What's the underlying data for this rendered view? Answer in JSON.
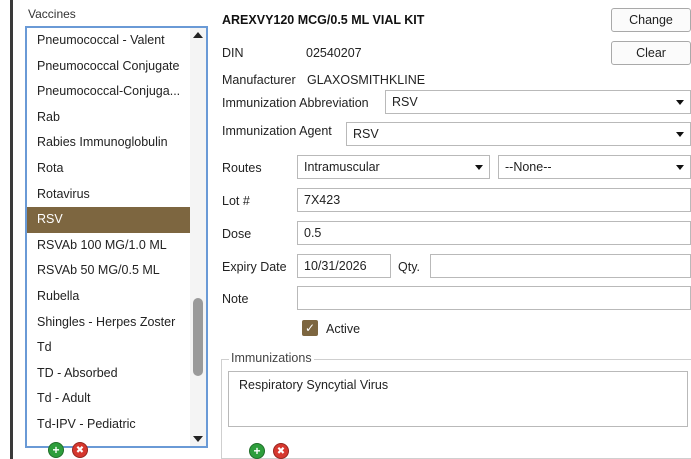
{
  "vaccines": {
    "title": "Vaccines",
    "items": [
      "Pneumococcal - Valent",
      "Pneumococcal Conjugate",
      "Pneumococcal-Conjuga...",
      "Rab",
      "Rabies Immunoglobulin",
      "Rota",
      "Rotavirus",
      "RSV",
      "RSVAb 100 MG/1.0 ML",
      "RSVAb 50 MG/0.5 ML",
      "Rubella",
      "Shingles - Herpes Zoster",
      "Td",
      "TD - Absorbed",
      "Td - Adult",
      "Td-IPV - Pediatric"
    ],
    "selected_index": 7,
    "add_glyph": "+",
    "remove_glyph": "✖"
  },
  "product": {
    "title": "AREXVY120 MCG/0.5 ML VIAL KIT",
    "change_label": "Change",
    "clear_label": "Clear"
  },
  "form": {
    "din_label": "DIN",
    "din_value": "02540207",
    "manufacturer_label": "Manufacturer",
    "manufacturer_value": "GLAXOSMITHKLINE",
    "abbreviation_label": "Immunization Abbreviation",
    "abbreviation_value": "RSV",
    "agent_label": "Immunization Agent",
    "agent_value": "RSV",
    "routes_label": "Routes",
    "route_value": "Intramuscular",
    "site_value": "--None--",
    "lot_label": "Lot #",
    "lot_value": "7X423",
    "dose_label": "Dose",
    "dose_value": "0.5",
    "expiry_label": "Expiry Date",
    "expiry_value": "10/31/2026",
    "qty_label": "Qty.",
    "qty_value": "",
    "note_label": "Note",
    "note_value": "",
    "active_label": "Active",
    "active_checked": true
  },
  "immunizations": {
    "title": "Immunizations",
    "items": [
      "Respiratory Syncytial Virus"
    ],
    "add_glyph": "+",
    "remove_glyph": "✖"
  },
  "colors": {
    "selection": "#7d6640",
    "list_border": "#6a9ad6",
    "add": "#2e9e3c",
    "remove": "#d6372e"
  }
}
